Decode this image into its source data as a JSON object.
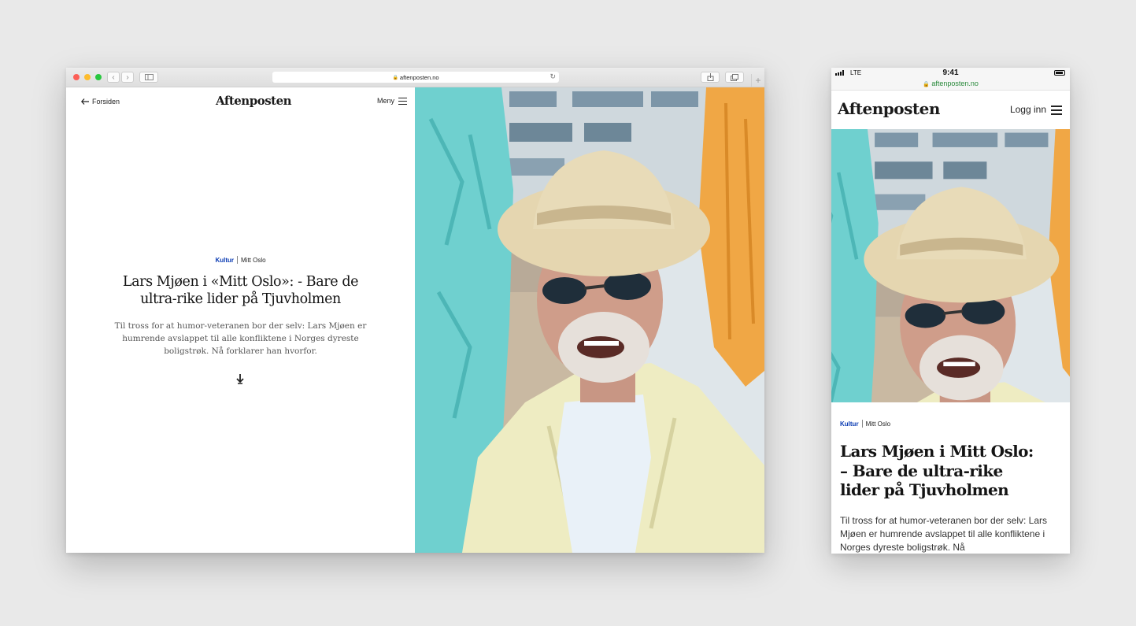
{
  "desktop": {
    "address_bar": "aftenposten.no",
    "nav": {
      "back_label": "Forsiden",
      "logo": "Aftenposten",
      "menu_label": "Meny"
    },
    "article": {
      "section": "Kultur",
      "series": "Mitt Oslo",
      "headline": "Lars Mjøen i «Mitt Oslo»: - Bare de ultra-rike lider på Tjuvholmen",
      "lead": "Til tross for at humor-veteranen bor der selv: Lars Mjøen er humrende avslappet til alle konfliktene i Norges dyreste boligstrøk. Nå forklarer han hvorfor."
    }
  },
  "mobile": {
    "status": {
      "carrier": "LTE",
      "time": "9:41",
      "url": "aftenposten.no"
    },
    "nav": {
      "logo": "Aftenposten",
      "login_label": "Logg inn"
    },
    "article": {
      "section": "Kultur",
      "series": "Mitt Oslo",
      "headline_lines": [
        "Lars Mjøen i Mitt Oslo:",
        "– Bare de ultra-rike",
        "lider på Tjuvholmen"
      ],
      "lead": "Til tross for at humor-veteranen bor der selv: Lars Mjøen er humrende avslappet til alle konfliktene i Norges dyreste boligstrøk. Nå"
    }
  },
  "colors": {
    "section_accent": "#0a3bb3",
    "secure_url": "#2a8a3c"
  },
  "icons": [
    "back-arrow-icon",
    "hamburger-menu-icon",
    "scroll-down-icon",
    "lock-icon",
    "reload-icon",
    "share-icon",
    "tabs-icon",
    "sidebar-icon"
  ]
}
